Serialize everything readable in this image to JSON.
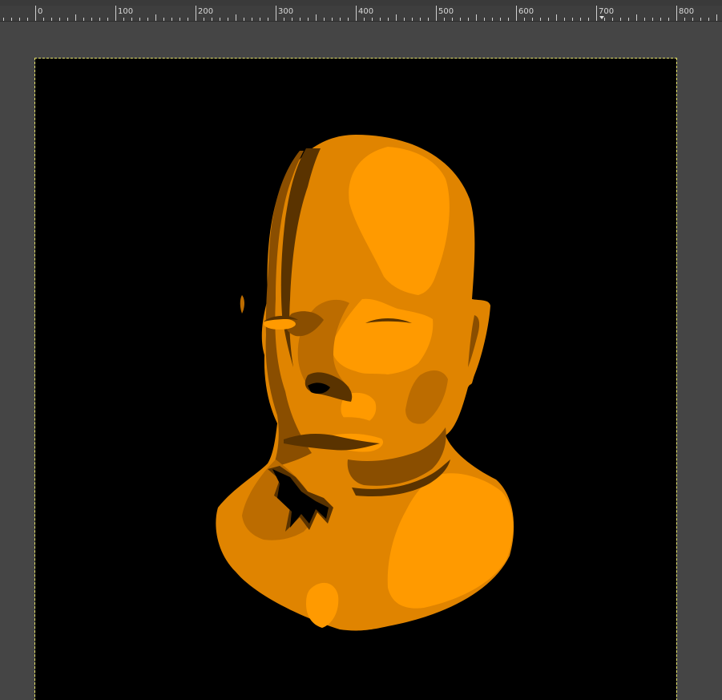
{
  "ruler": {
    "labels": [
      "0",
      "100",
      "200",
      "300",
      "400",
      "500",
      "600",
      "700",
      "800"
    ]
  },
  "canvas": {
    "image": "orange-posterized-head-bust",
    "background_color": "#000000",
    "palette": [
      "#ff9a00",
      "#e08400",
      "#bc6c00",
      "#8a4e00",
      "#5a3300"
    ]
  }
}
